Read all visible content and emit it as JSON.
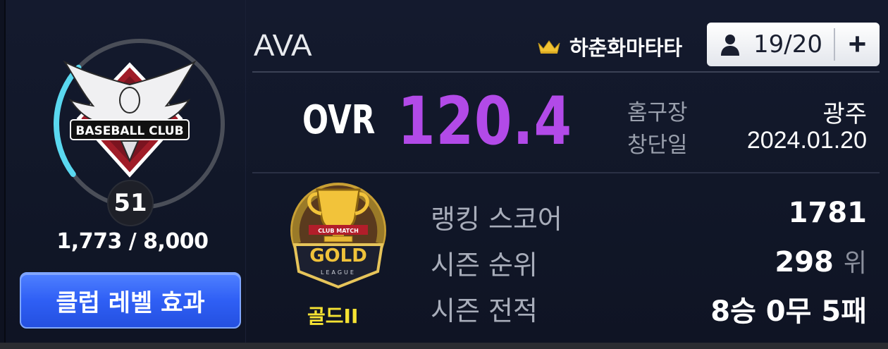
{
  "club": {
    "name": "AVA",
    "emblem_text": "BASEBALL CLUB",
    "level": "51",
    "exp": "1,773 / 8,000",
    "exp_progress": 0.2216,
    "level_effect_label": "클럽 레벨 효과"
  },
  "owner": {
    "name": "하춘화마타타",
    "icon": "crown-icon"
  },
  "members": {
    "count": "19/20",
    "add_label": "+",
    "icon": "person-icon"
  },
  "overall": {
    "label": "OVR",
    "value": "120.4"
  },
  "info": {
    "home_label": "홈구장",
    "home_value": "광주",
    "founded_label": "창단일",
    "founded_value": "2024.01.20"
  },
  "league": {
    "emblem_top": "CLUB MATCH",
    "emblem_title": "GOLD",
    "emblem_sub": "LEAGUE",
    "name": "골드II"
  },
  "stats": {
    "ranking_score_label": "랭킹 스코어",
    "ranking_score_value": "1781",
    "season_rank_label": "시즌 순위",
    "season_rank_value": "298",
    "season_rank_unit": "위",
    "season_record_label": "시즌 전적",
    "season_record_value": "8승 0무 5패"
  },
  "colors": {
    "ovr": "#b24ae8",
    "league_name": "#f5e233",
    "ring_progress": "#5ad8f0",
    "button": "#2f5ff5"
  }
}
